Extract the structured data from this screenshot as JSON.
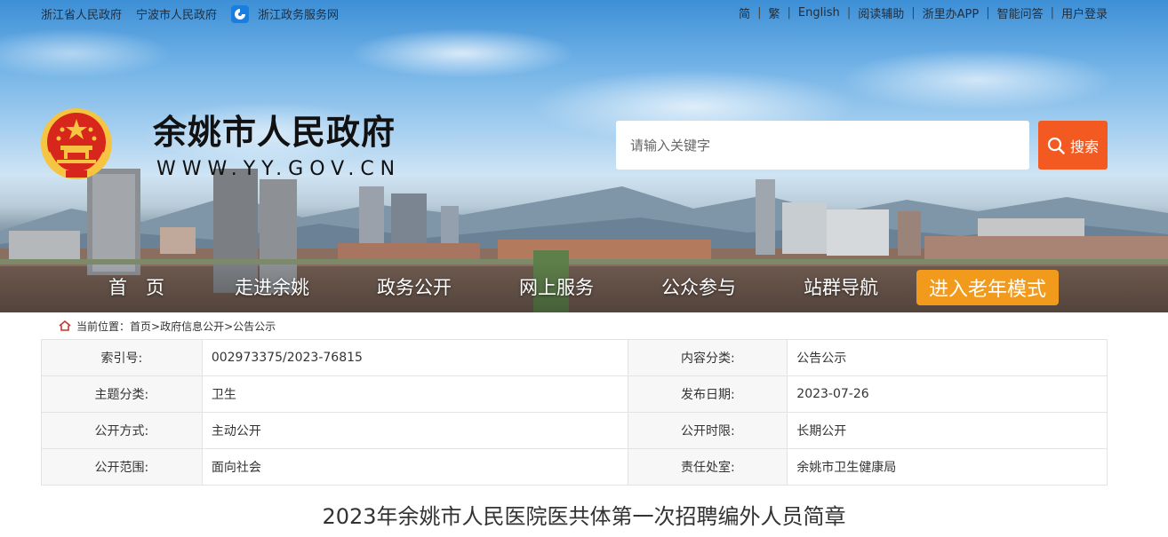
{
  "top_links_left": [
    "浙江省人民政府",
    "宁波市人民政府",
    "浙江政务服务网"
  ],
  "top_links_right": [
    "简",
    "繁",
    "English",
    "阅读辅助",
    "浙里办APP",
    "智能问答",
    "用户登录"
  ],
  "site": {
    "title": "余姚市人民政府",
    "url": "WWW.YY.GOV.CN"
  },
  "search": {
    "placeholder": "请输入关键字",
    "button_label": "搜索"
  },
  "nav": {
    "items": [
      "首　页",
      "走进余姚",
      "政务公开",
      "网上服务",
      "公众参与",
      "站群导航"
    ],
    "elder_mode": "进入老年模式"
  },
  "breadcrumb": {
    "prefix": "当前位置：",
    "items": [
      "首页>",
      "政府信息公开>",
      "公告公示"
    ]
  },
  "info": [
    {
      "label1": "索引号:",
      "value1": "002973375/2023-76815",
      "label2": "内容分类:",
      "value2": "公告公示"
    },
    {
      "label1": "主题分类:",
      "value1": "卫生",
      "label2": "发布日期:",
      "value2": "2023-07-26"
    },
    {
      "label1": "公开方式:",
      "value1": "主动公开",
      "label2": "公开时限:",
      "value2": "长期公开"
    },
    {
      "label1": "公开范围:",
      "value1": "面向社会",
      "label2": "责任处室:",
      "value2": "余姚市卫生健康局"
    }
  ],
  "article": {
    "title": "2023年余姚市人民医院医共体第一次招聘编外人员简章"
  },
  "colors": {
    "search_button": "#f25a22",
    "elder_button": "#f19a1c",
    "emblem_red": "#d7261b",
    "emblem_gold": "#f5c542"
  }
}
